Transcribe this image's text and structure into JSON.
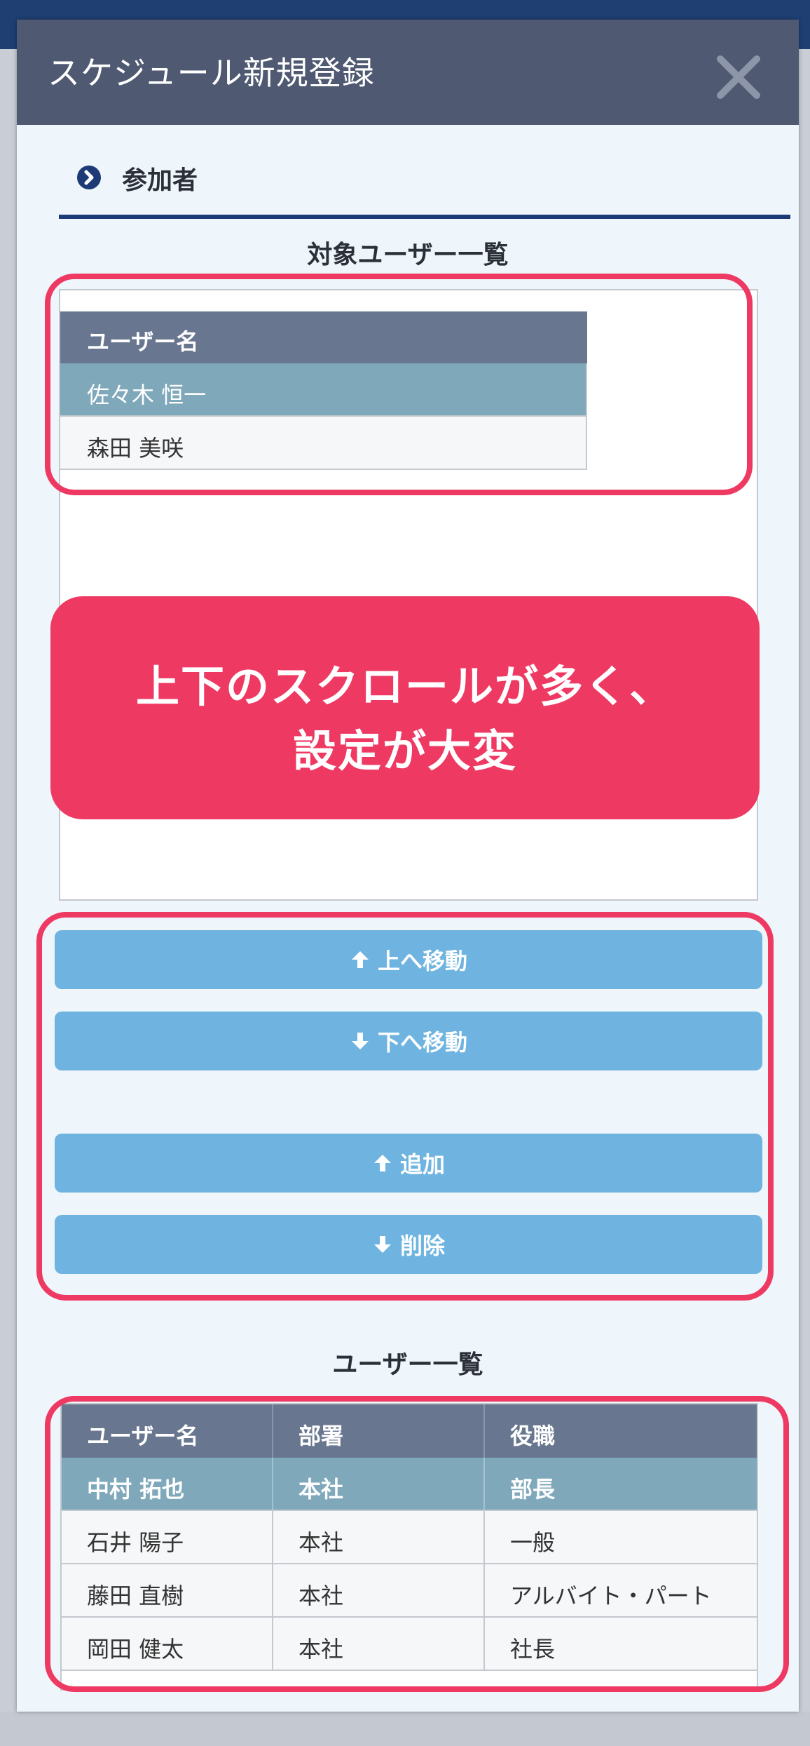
{
  "modal": {
    "title": "スケジュール新規登録",
    "close_icon": "close-icon"
  },
  "section": {
    "label": "参加者",
    "bullet_icon": "chevron-right-circle-icon"
  },
  "target_list": {
    "caption": "対象ユーザー一覧",
    "column_header": "ユーザー名",
    "rows": [
      "佐々木 恒一",
      "森田 美咲"
    ],
    "selected_index": 0
  },
  "buttons": {
    "move_up": "上へ移動",
    "move_down": "下へ移動",
    "add": "追加",
    "remove": "削除",
    "up_icon": "arrow-up-icon",
    "down_icon": "arrow-down-icon"
  },
  "user_list": {
    "caption": "ユーザー一覧",
    "columns": [
      "ユーザー名",
      "部署",
      "役職"
    ],
    "rows": [
      [
        "中村 拓也",
        "本社",
        "部長"
      ],
      [
        "石井 陽子",
        "本社",
        "一般"
      ],
      [
        "藤田 直樹",
        "本社",
        "アルバイト・パート"
      ],
      [
        "岡田 健太",
        "本社",
        "社長"
      ]
    ],
    "selected_index": 0
  },
  "annotation": {
    "line1": "上下のスクロールが多く、",
    "line2": "設定が大変",
    "color": "#ee3a63"
  },
  "colors": {
    "header_bg": "#4f5a72",
    "table_header": "#68778f",
    "selected_row": "#7fa8bb",
    "button": "#6fb4e0",
    "accent_navy": "#1d3a76"
  }
}
